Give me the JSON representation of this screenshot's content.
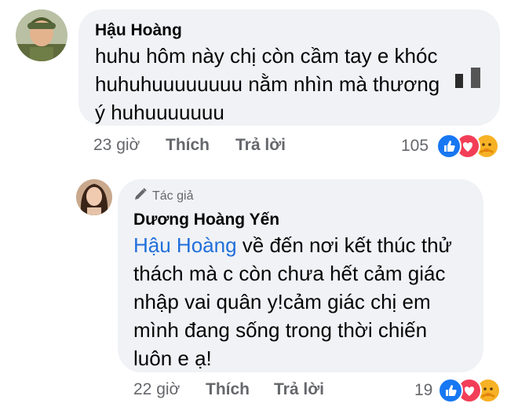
{
  "comments": [
    {
      "author": "Hậu Hoàng",
      "lines": [
        "huhu hôm này chị còn cầm tay e khóc",
        "huhuhuuuuuuuu nằm nhìn mà thương",
        "ý huhuuuuuuu"
      ],
      "time": "23 giờ",
      "like_label": "Thích",
      "reply_label": "Trả lời",
      "reaction_count": "105",
      "reactions": [
        "like-icon",
        "love-icon",
        "care-icon"
      ]
    },
    {
      "author_badge": "Tác giả",
      "author": "Dương Hoàng Yến",
      "mention": "Hậu Hoàng",
      "lines": [
        " về đến nơi kết thúc thử",
        "thách mà c còn chưa hết cảm giác",
        "nhập vai quân y!cảm giác chị em",
        "mình đang sống trong thời chiến",
        "luôn e ạ!"
      ],
      "time": "22 giờ",
      "like_label": "Thích",
      "reply_label": "Trả lời",
      "reaction_count": "19",
      "reactions": [
        "like-icon",
        "love-icon",
        "care-icon"
      ]
    }
  ],
  "colors": {
    "bubble": "#f0f2f5",
    "meta": "#65676b",
    "mention": "#216fdb",
    "like": "#1877f2",
    "love": "#f33e58",
    "care": "#f7b125"
  }
}
